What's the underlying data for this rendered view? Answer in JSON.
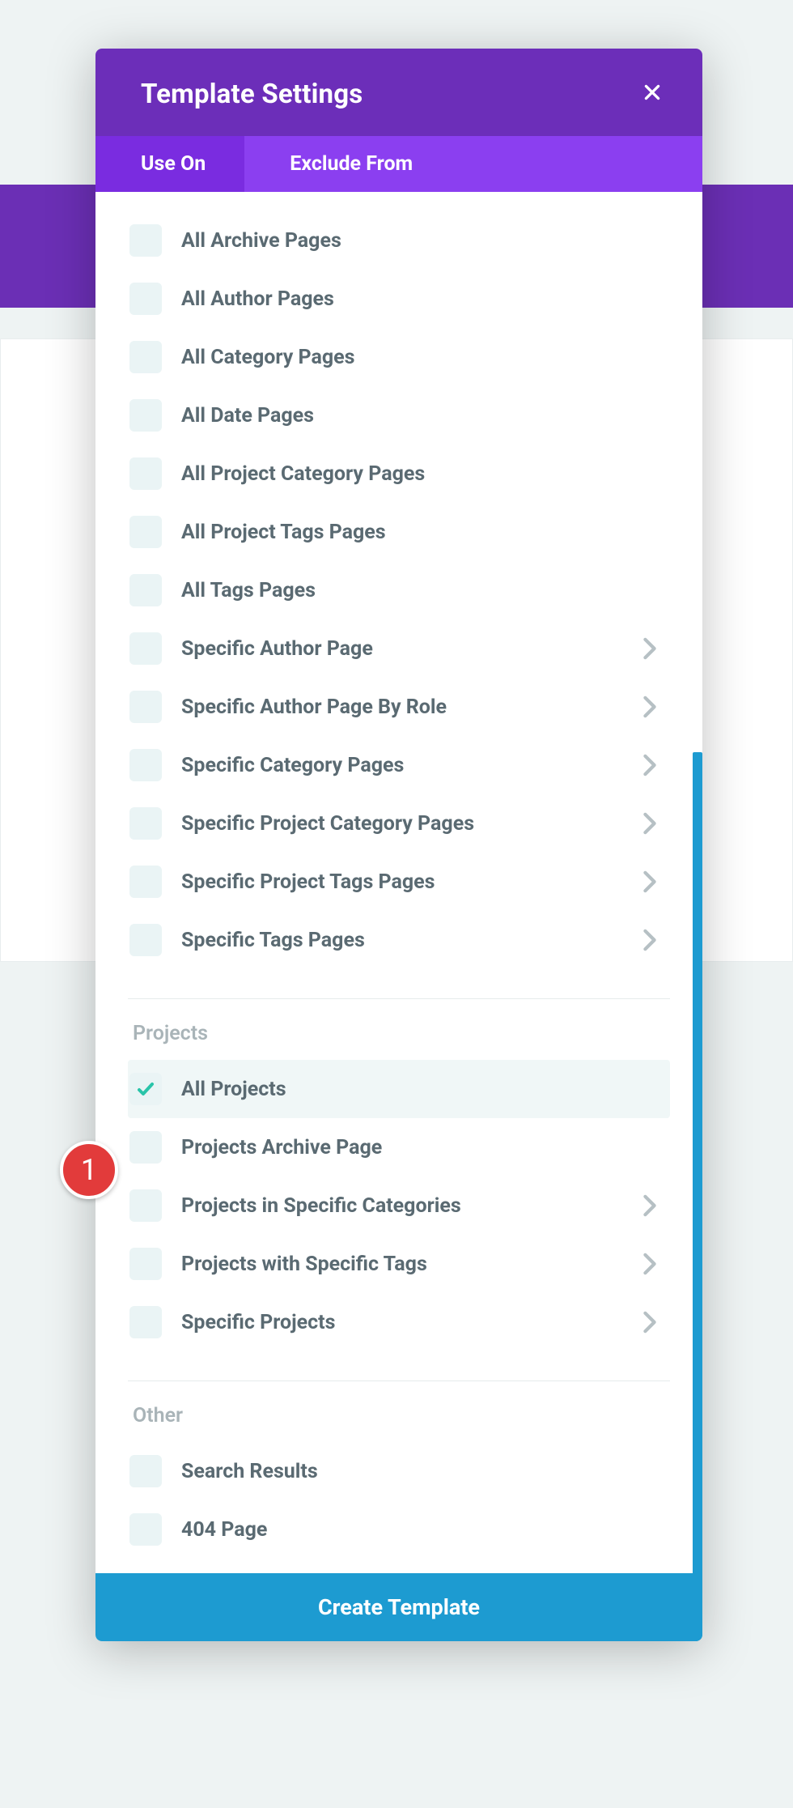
{
  "modal": {
    "title": "Template Settings",
    "tabs": {
      "use_on": "Use On",
      "exclude_from": "Exclude From"
    },
    "footer_button": "Create Template"
  },
  "groups": {
    "archive": {
      "items": [
        {
          "label": "All Archive Pages",
          "has_sub": false,
          "checked": false
        },
        {
          "label": "All Author Pages",
          "has_sub": false,
          "checked": false
        },
        {
          "label": "All Category Pages",
          "has_sub": false,
          "checked": false
        },
        {
          "label": "All Date Pages",
          "has_sub": false,
          "checked": false
        },
        {
          "label": "All Project Category Pages",
          "has_sub": false,
          "checked": false
        },
        {
          "label": "All Project Tags Pages",
          "has_sub": false,
          "checked": false
        },
        {
          "label": "All Tags Pages",
          "has_sub": false,
          "checked": false
        },
        {
          "label": "Specific Author Page",
          "has_sub": true,
          "checked": false
        },
        {
          "label": "Specific Author Page By Role",
          "has_sub": true,
          "checked": false
        },
        {
          "label": "Specific Category Pages",
          "has_sub": true,
          "checked": false
        },
        {
          "label": "Specific Project Category Pages",
          "has_sub": true,
          "checked": false
        },
        {
          "label": "Specific Project Tags Pages",
          "has_sub": true,
          "checked": false
        },
        {
          "label": "Specific Tags Pages",
          "has_sub": true,
          "checked": false
        }
      ]
    },
    "projects": {
      "title": "Projects",
      "items": [
        {
          "label": "All Projects",
          "has_sub": false,
          "checked": true
        },
        {
          "label": "Projects Archive Page",
          "has_sub": false,
          "checked": false
        },
        {
          "label": "Projects in Specific Categories",
          "has_sub": true,
          "checked": false
        },
        {
          "label": "Projects with Specific Tags",
          "has_sub": true,
          "checked": false
        },
        {
          "label": "Specific Projects",
          "has_sub": true,
          "checked": false
        }
      ]
    },
    "other": {
      "title": "Other",
      "items": [
        {
          "label": "Search Results",
          "has_sub": false,
          "checked": false
        },
        {
          "label": "404 Page",
          "has_sub": false,
          "checked": false
        }
      ]
    }
  },
  "annotation": {
    "badge_1": "1"
  },
  "colors": {
    "header": "#6c2eb9",
    "tabbar": "#8b3ff0",
    "tab_active": "#7a2ce0",
    "accent_blue": "#1d9bd1",
    "check_teal": "#29c4a9",
    "annotation_red": "#e23b3b"
  }
}
